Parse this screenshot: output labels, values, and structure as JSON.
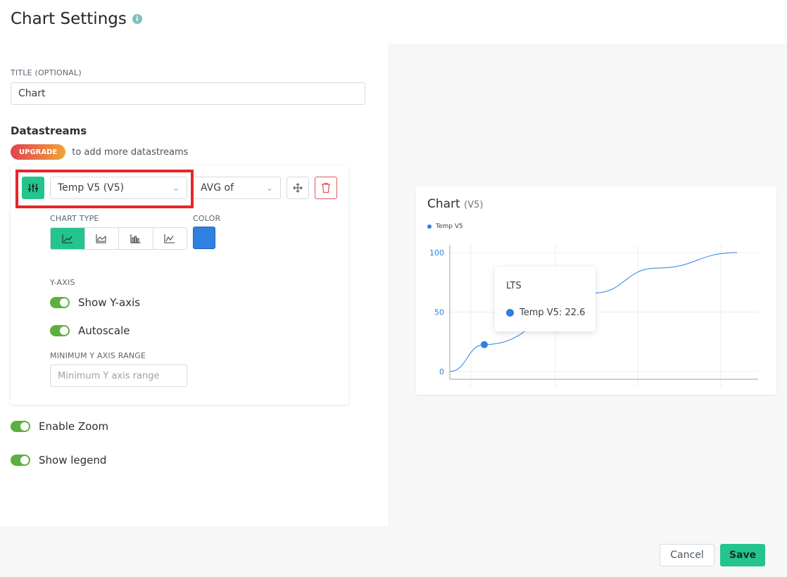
{
  "header": {
    "title": "Chart Settings",
    "info_icon": "info-icon"
  },
  "title_field": {
    "label": "TITLE (OPTIONAL)",
    "value": "Chart"
  },
  "datastreams": {
    "heading": "Datastreams",
    "upgrade_label": "UPGRADE",
    "upgrade_text": "to add more datastreams",
    "selected": "Temp V5 (V5)",
    "aggregation": "AVG of",
    "chart_type_label": "CHART TYPE",
    "color_label": "COLOR",
    "color": "#2f80e0",
    "chart_types": [
      "line",
      "area",
      "bar",
      "binary"
    ],
    "active_chart_type": "line",
    "yaxis_label": "Y-AXIS",
    "show_yaxis": "Show Y-axis",
    "autoscale": "Autoscale",
    "min_range_label": "MINIMUM Y AXIS RANGE",
    "min_range_placeholder": "Minimum Y axis range"
  },
  "options": {
    "enable_zoom": "Enable Zoom",
    "show_legend": "Show legend"
  },
  "preview": {
    "title": "Chart",
    "pin": "(V5)",
    "legend": "Temp V5",
    "tooltip_title": "LTS",
    "tooltip_value": "Temp V5: 22.6"
  },
  "chart_data": {
    "type": "line",
    "series": [
      {
        "name": "Temp V5",
        "color": "#2f80e0"
      }
    ],
    "y_ticks": [
      "100",
      "50",
      "0"
    ],
    "ylim": [
      0,
      100
    ],
    "points": [
      [
        0,
        0
      ],
      [
        0.12,
        22.6
      ],
      [
        0.5,
        66
      ],
      [
        0.72,
        87
      ],
      [
        1.0,
        100
      ]
    ],
    "highlight_index": 1,
    "grid": true
  },
  "footer": {
    "cancel": "Cancel",
    "save": "Save"
  }
}
